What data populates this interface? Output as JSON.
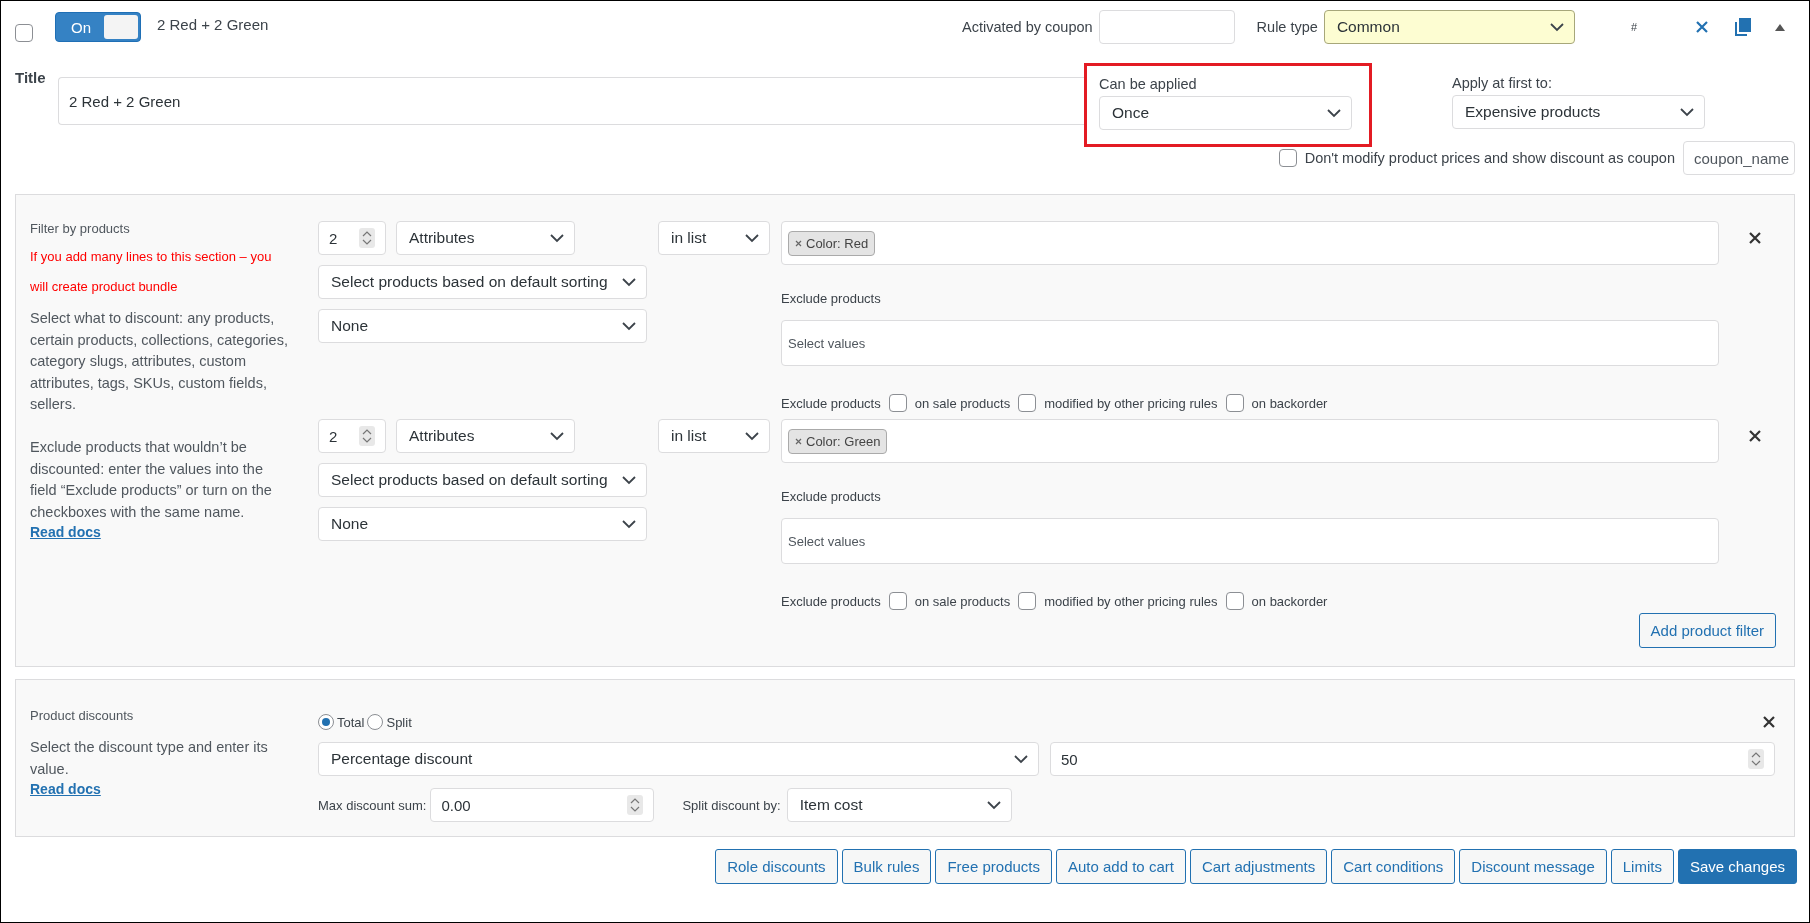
{
  "header": {
    "selected": false,
    "toggle": {
      "label": "On",
      "on": true
    },
    "rule_name": "2 Red + 2 Green",
    "coupon": {
      "label": "Activated by coupon"
    },
    "rule_type": {
      "label": "Rule type",
      "value": "Common"
    },
    "hash": "#"
  },
  "title": {
    "label": "Title",
    "value": "2 Red + 2 Green"
  },
  "can_be_applied": {
    "label": "Can be applied",
    "value": "Once",
    "highlighted": true
  },
  "apply_first": {
    "label": "Apply at first to:",
    "value": "Expensive products"
  },
  "coupon_option": {
    "checked": false,
    "label": "Don't modify product prices and show discount as coupon",
    "value": "coupon_name"
  },
  "filter_section": {
    "title": "Filter by products",
    "warning": "If you add many lines to this section – you will create product bundle",
    "description": "Select what to discount: any products, certain products, collections, categories, category slugs, attributes, custom attributes, tags, SKUs, custom fields, sellers.",
    "exclude_help": "Exclude products that wouldn’t be discounted: enter the values into the field “Exclude products” or turn on the checkboxes with the same name.",
    "docs_link": "Read docs",
    "rows": [
      {
        "qty": "2",
        "type": "Attributes",
        "sorting": "Select products based on default sorting",
        "limit": "None",
        "operator": "in list",
        "tags": [
          "Color: Red"
        ],
        "exclude_label": "Exclude products",
        "exclude_placeholder": "Select values",
        "checks_label": "Exclude products",
        "checks": [
          {
            "label": "on sale products",
            "checked": false
          },
          {
            "label": "modified by other pricing rules",
            "checked": false
          },
          {
            "label": "on backorder",
            "checked": false
          }
        ]
      },
      {
        "qty": "2",
        "type": "Attributes",
        "sorting": "Select products based on default sorting",
        "limit": "None",
        "operator": "in list",
        "tags": [
          "Color: Green"
        ],
        "exclude_label": "Exclude products",
        "exclude_placeholder": "Select values",
        "checks_label": "Exclude products",
        "checks": [
          {
            "label": "on sale products",
            "checked": false
          },
          {
            "label": "modified by other pricing rules",
            "checked": false
          },
          {
            "label": "on backorder",
            "checked": false
          }
        ]
      }
    ],
    "add_button": "Add product filter"
  },
  "discount_section": {
    "title": "Product discounts",
    "description": "Select the discount type and enter its value.",
    "docs_link": "Read docs",
    "modes": [
      {
        "label": "Total",
        "selected": true
      },
      {
        "label": "Split",
        "selected": false
      }
    ],
    "type": "Percentage discount",
    "value": "50",
    "max_label": "Max discount sum:",
    "max_value": "0.00",
    "split_label": "Split discount by:",
    "split_value": "Item cost"
  },
  "buttons": [
    {
      "label": "Role discounts",
      "kind": "outline"
    },
    {
      "label": "Bulk rules",
      "kind": "outline"
    },
    {
      "label": "Free products",
      "kind": "outline"
    },
    {
      "label": "Auto add to cart",
      "kind": "outline"
    },
    {
      "label": "Cart adjustments",
      "kind": "outline"
    },
    {
      "label": "Cart conditions",
      "kind": "outline"
    },
    {
      "label": "Discount message",
      "kind": "outline"
    },
    {
      "label": "Limits",
      "kind": "outline"
    },
    {
      "label": "Save changes",
      "kind": "primary"
    }
  ]
}
